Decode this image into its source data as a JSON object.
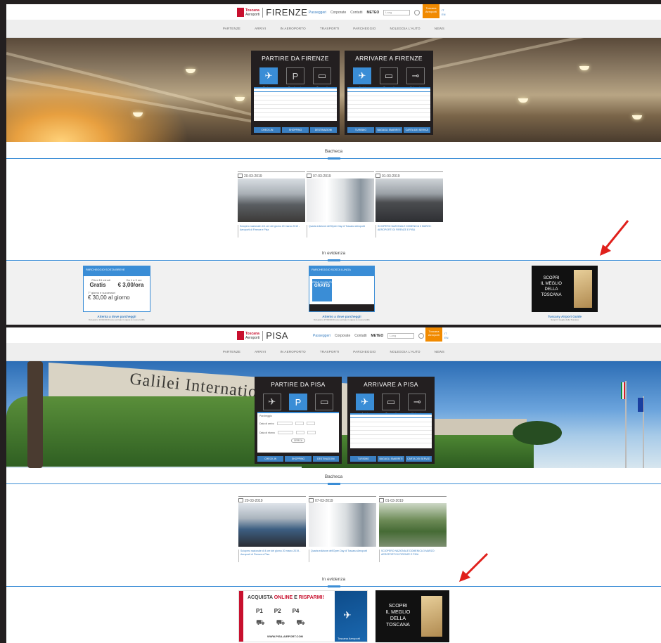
{
  "firenze": {
    "logo": {
      "line1": "Toscana",
      "line2": "Aeroporti",
      "city": "FIRENZE"
    },
    "topbar": {
      "passeggeri": "Passeggeri",
      "corporate": "Corporate",
      "contatti": "Contatti",
      "meteo": "METEO",
      "lang": "Lang",
      "orange": "Toscana Aeroporti",
      "tiny1": "IT",
      "tiny2": "EN"
    },
    "nav": [
      "PARTENZE",
      "ARRIVI",
      "IN AEROPORTO",
      "TRASPORTI",
      "PARCHEGGIO",
      "NOLEGGIA L'AUTO",
      "NEWS"
    ],
    "panel_left": {
      "title": "PARTIRE DA FIRENZE",
      "icons": [
        "Partenze",
        "Parcheggio",
        "Trasporti"
      ],
      "buttons": [
        "CHECK-IN",
        "SHOPPING",
        "DESTINAZIONI"
      ]
    },
    "panel_right": {
      "title": "ARRIVARE A FIRENZE",
      "icons": [
        "Arrivi",
        "Trasporti",
        "Noleggio"
      ],
      "buttons": [
        "TURISMO",
        "BAGAGLI SMARRITI",
        "CARTA DEI SERVIZI"
      ]
    },
    "bacheca": "Bacheca",
    "news": [
      {
        "date": "20-03-2019",
        "caption": "Sciopero nazionale di 4 ore del giorno 20 marzo 2019 - Aeroporti di Firenze e Pisa"
      },
      {
        "date": "07-03-2019",
        "caption": "Quarta edizione dell'Open Day di Toscana Aeroporti"
      },
      {
        "date": "01-03-2019",
        "caption": "SCIOPERO NAZIONALE DOMENICA 3 MARZO: AEROPORTI DI FIRENZE E PISA"
      }
    ],
    "evidenza": "In evidenza",
    "cards": [
      {
        "title": "Attenta a dove parcheggi!",
        "sub": "Dal giorno 13/01/2019 sono entrate in vigore le nuove tariffe",
        "lines": [
          "PARCHEGGIO SOSTA BREVE",
          "Primi 15 minuti",
          "Gratis",
          "Da 1 a 3 ore",
          "€ 3,00/ora",
          "7° giorno e successivi",
          "€ 30,00 al giorno"
        ]
      },
      {
        "title": "Attento a dove parcheggi!",
        "sub": "Dal giorno 27/01/2019 sono entrate in vigore le nuove tariffe",
        "lines": [
          "PARCHEGGIO SOSTA LUNGA",
          "PRIMI 15 MINUTI",
          "GRATIS"
        ]
      },
      {
        "title": "Tuscany Airport Guide",
        "sub": "Scopri il meglio della Toscana",
        "lines": [
          "SCOPRI",
          "IL MEGLIO",
          "DELLA",
          "TOSCANA"
        ]
      }
    ]
  },
  "pisa": {
    "logo": {
      "line1": "Toscana",
      "line2": "Aeroporti",
      "city": "PISA"
    },
    "topbar": {
      "passeggeri": "Passeggeri",
      "corporate": "Corporate",
      "contatti": "Contatti",
      "meteo": "METEO",
      "lang": "Lang",
      "orange": "Toscana Aeroporti",
      "tiny1": "IT",
      "tiny2": "EN"
    },
    "nav": [
      "PARTENZE",
      "ARRIVI",
      "IN AEROPORTO",
      "TRASPORTI",
      "PARCHEGGIO",
      "NOLEGGIA L'AUTO",
      "NEWS"
    ],
    "hero_sign": "Galilei Internatio",
    "panel_left": {
      "title": "PARTIRE DA PISA",
      "icons": [
        "Partenze",
        "Parcheggio",
        "Trasporti"
      ],
      "buttons": [
        "CHECK-IN",
        "SHOPPING",
        "DESTINAZIONI"
      ],
      "form": [
        "Parcheggio",
        "Data di arrivo",
        "Data di ritorno",
        "CERCA"
      ]
    },
    "panel_right": {
      "title": "ARRIVARE A PISA",
      "icons": [
        "Arrivi",
        "Trasporti",
        "Noleggio"
      ],
      "buttons": [
        "TURISMO",
        "BAGAGLI SMARRITI",
        "CARTA DEI SERVIZI"
      ]
    },
    "bacheca": "Bacheca",
    "news": [
      {
        "date": "20-03-2019",
        "caption": "Sciopero nazionale di 4 ore del giorno 20 marzo 2019 - Aeroporti di Firenze e Pisa"
      },
      {
        "date": "07-03-2019",
        "caption": "Quarta edizione dell'Open Day di Toscana Aeroporti"
      },
      {
        "date": "01-03-2019",
        "caption": "SCIOPERO NAZIONALE DOMENICA 3 MARZO: AEROPORTI DI FIRENZE E PISA"
      }
    ],
    "evidenza": "In evidenza",
    "banner": {
      "headline1": "ACQUISTA",
      "headline2": "ONLINE",
      "headline3": "E",
      "headline4": "RISPARMI!",
      "slots": [
        "P1",
        "P2",
        "P4"
      ],
      "url": "WWW.PISA-AIRPORT.COM",
      "brand": "Toscana Aeroporti"
    },
    "guide": [
      "SCOPRI",
      "IL MEGLIO",
      "DELLA",
      "TOSCANA"
    ]
  },
  "colors": {
    "accent": "#3a8dd6",
    "arrow": "#e0201b",
    "orange": "#f18a00",
    "brand_red": "#c8102e"
  }
}
